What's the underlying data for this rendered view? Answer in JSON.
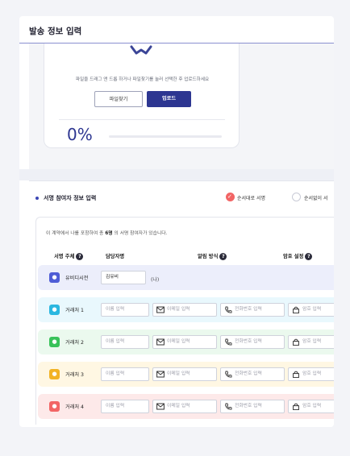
{
  "header": {
    "title": "발송 정보 입력"
  },
  "upload": {
    "hint": "파일을 드래그 앤 드롭 하거나 파일찾기를 눌러 선택한 후 업로드하세요",
    "find_button": "파일찾기",
    "upload_button": "업로드",
    "progress_label": "0%",
    "progress_value": 0
  },
  "signers": {
    "section_title": "서명 참여자 정보 입력",
    "order_options": [
      {
        "label": "순서대로 서명",
        "selected": true
      },
      {
        "label": "순서없이 서",
        "selected": false
      }
    ],
    "note_prefix": "이 계약에서 나를 포함하여 총 ",
    "note_count": "6명",
    "note_suffix": " 의 서명 참여자가 있습니다.",
    "columns": [
      "서명 주체",
      "담당자명",
      "알림 방식",
      "암호 설정"
    ],
    "owner": {
      "role": "유비디시전",
      "name": "김유비",
      "me_label": "(나)"
    },
    "placeholders": {
      "name": "이름 입력",
      "email": "이메일 입력",
      "phone": "전화번호 입력",
      "password": "암호 입력"
    },
    "rows": [
      {
        "role": "거래처 1",
        "color": "#2bb7e0",
        "bg": "#e9f8fd"
      },
      {
        "role": "거래처 2",
        "color": "#39c25a",
        "bg": "#ebf9ee"
      },
      {
        "role": "거래처 3",
        "color": "#f2b325",
        "bg": "#fff7e3"
      },
      {
        "role": "거래처 4",
        "color": "#f26565",
        "bg": "#fde9e9"
      }
    ],
    "owner_color": "#4f5dd6",
    "owner_bg": "#eceefb"
  }
}
